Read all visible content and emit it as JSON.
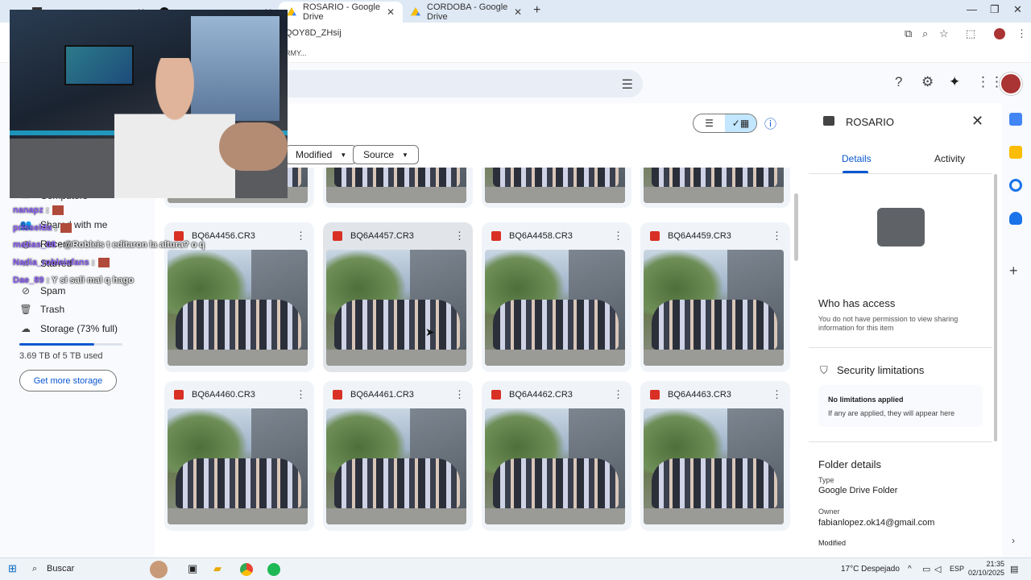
{
  "browser": {
    "tabs": [
      {
        "title": "",
        "active": false
      },
      {
        "title": "",
        "active": false
      },
      {
        "title": "ROSARIO - Google Drive",
        "active": true
      },
      {
        "title": "CORDOBA - Google Drive",
        "active": false
      }
    ],
    "url_fragment": "QOY8D_ZHsij",
    "bookmark_fragment": "RMY..."
  },
  "drive": {
    "filters": {
      "modified": "Modified",
      "source": "Source"
    },
    "nav": {
      "computers": "Computers",
      "shared": "Shared with me",
      "recent": "Recent",
      "starred": "Starred",
      "spam": "Spam",
      "trash": "Trash",
      "storage": "Storage (73% full)"
    },
    "storage_used_text": "3.69 TB of 5 TB used",
    "storage_fraction": 0.73,
    "get_storage": "Get more storage",
    "files_row1": [
      "BQ6A4456.CR3",
      "BQ6A4457.CR3",
      "BQ6A4458.CR3",
      "BQ6A4459.CR3"
    ],
    "files_row2": [
      "BQ6A4460.CR3",
      "BQ6A4461.CR3",
      "BQ6A4462.CR3",
      "BQ6A4463.CR3"
    ]
  },
  "details": {
    "folder_name": "ROSARIO",
    "tab_details": "Details",
    "tab_activity": "Activity",
    "who_has_access": "Who has access",
    "access_note": "You do not have permission to view sharing information for this item",
    "security_title": "Security limitations",
    "no_limitations": "No limitations applied",
    "no_limitations_note": "If any are applied, they will appear here",
    "folder_details": "Folder details",
    "type_label": "Type",
    "type_value": "Google Drive Folder",
    "owner_label": "Owner",
    "owner_value": "fabianlopez.ok14@gmail.com",
    "modified_label": "Modified"
  },
  "chat": [
    {
      "user": "nanapz",
      "msg": ":"
    },
    {
      "user": "prisselda",
      "msg": ":"
    },
    {
      "user": "matias_08",
      "msg": ": @Robleis t editaron la altura? o q"
    },
    {
      "user": "Nadia_robleisfans",
      "msg": ":"
    },
    {
      "user": "Dae_89",
      "msg": ": Y si sali mal q hago"
    }
  ],
  "taskbar": {
    "search": "Buscar",
    "weather": "17°C  Despejado",
    "lang": "ESP",
    "time": "21:35",
    "date": "02/10/2025"
  }
}
